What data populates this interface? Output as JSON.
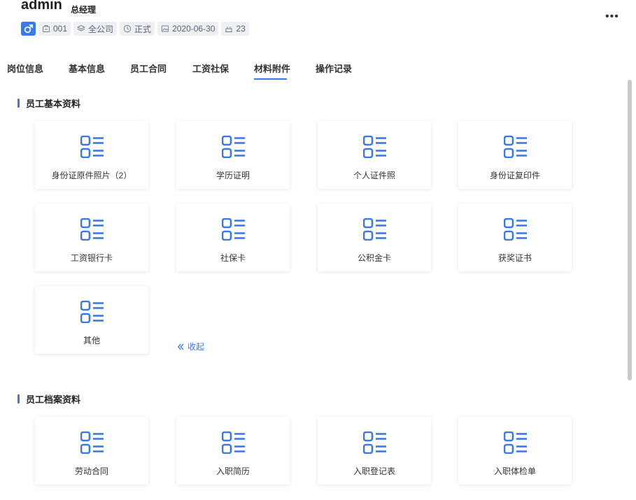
{
  "header": {
    "name": "admin",
    "role": "总经理",
    "more_label": "•••",
    "gender_icon": "male-icon",
    "badges": [
      {
        "icon": "id-card-icon",
        "text": "001"
      },
      {
        "icon": "layers-icon",
        "text": "全公司"
      },
      {
        "icon": "clock-icon",
        "text": "正式"
      },
      {
        "icon": "calendar-image-icon",
        "text": "2020-06-30"
      },
      {
        "icon": "cake-icon",
        "text": "23"
      }
    ]
  },
  "tabs": [
    {
      "label": "岗位信息"
    },
    {
      "label": "基本信息"
    },
    {
      "label": "员工合同"
    },
    {
      "label": "工资社保"
    },
    {
      "label": "材料附件"
    },
    {
      "label": "操作记录"
    }
  ],
  "active_tab": "材料附件",
  "sections": {
    "basic": {
      "title": "员工基本资料",
      "cards": [
        "身份证原件照片（2）",
        "学历证明",
        "个人证件照",
        "身份证复印件",
        "工资银行卡",
        "社保卡",
        "公积金卡",
        "获奖证书",
        "其他"
      ],
      "collapse_label": "收起"
    },
    "archive": {
      "title": "员工档案资料",
      "cards": [
        "劳动合同",
        "入职简历",
        "入职登记表",
        "入职体检单"
      ]
    }
  },
  "colors": {
    "accent": "#3a7ae8",
    "badge_bg": "#eef0f3"
  }
}
